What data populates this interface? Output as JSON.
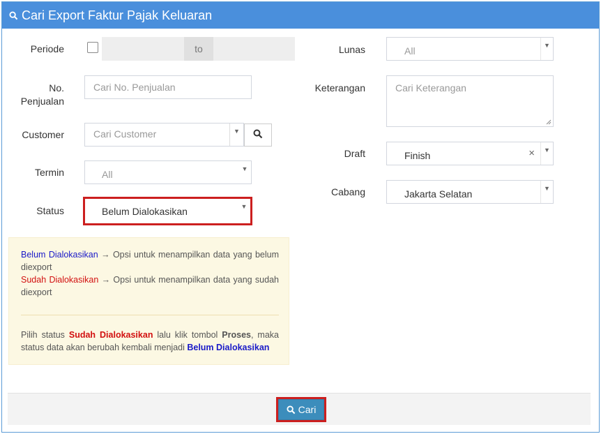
{
  "header": {
    "title": "Cari Export Faktur Pajak Keluaran"
  },
  "left": {
    "periode_label": "Periode",
    "periode_to": "to",
    "no_penjualan_label_1": "No.",
    "no_penjualan_label_2": "Penjualan",
    "no_penjualan_placeholder": "Cari No. Penjualan",
    "customer_label": "Customer",
    "customer_placeholder": "Cari Customer",
    "termin_label": "Termin",
    "termin_value": "All",
    "status_label": "Status",
    "status_value": "Belum Dialokasikan"
  },
  "right": {
    "lunas_label": "Lunas",
    "lunas_value": "All",
    "keterangan_label": "Keterangan",
    "keterangan_placeholder": "Cari Keterangan",
    "draft_label": "Draft",
    "draft_value": "Finish",
    "draft_clear": "×",
    "cabang_label": "Cabang",
    "cabang_value": "Jakarta Selatan"
  },
  "info": {
    "line1_term": "Belum Dialokasikan",
    "line1_text": " → Opsi untuk menampilkan data yang belum diexport",
    "line2_term": "Sudah Dialokasikan",
    "line2_text": " → Opsi untuk menampilkan data yang sudah diexport",
    "note_1": "Pilih status ",
    "note_sudah": "Sudah Dialokasikan",
    "note_2": " lalu klik tombol ",
    "note_proses": "Proses",
    "note_3": ", maka status data akan berubah kembali menjadi ",
    "note_belum": "Belum Dialokasikan"
  },
  "footer": {
    "cari_label": "Cari"
  },
  "icons": {
    "search": "search-icon",
    "caret": "caret-down-icon",
    "clear": "clear-icon"
  },
  "colors": {
    "header": "#4a8fdc",
    "button": "#3c8dbc",
    "highlight": "#cc1f1f",
    "info_bg": "#fcf8e3"
  }
}
